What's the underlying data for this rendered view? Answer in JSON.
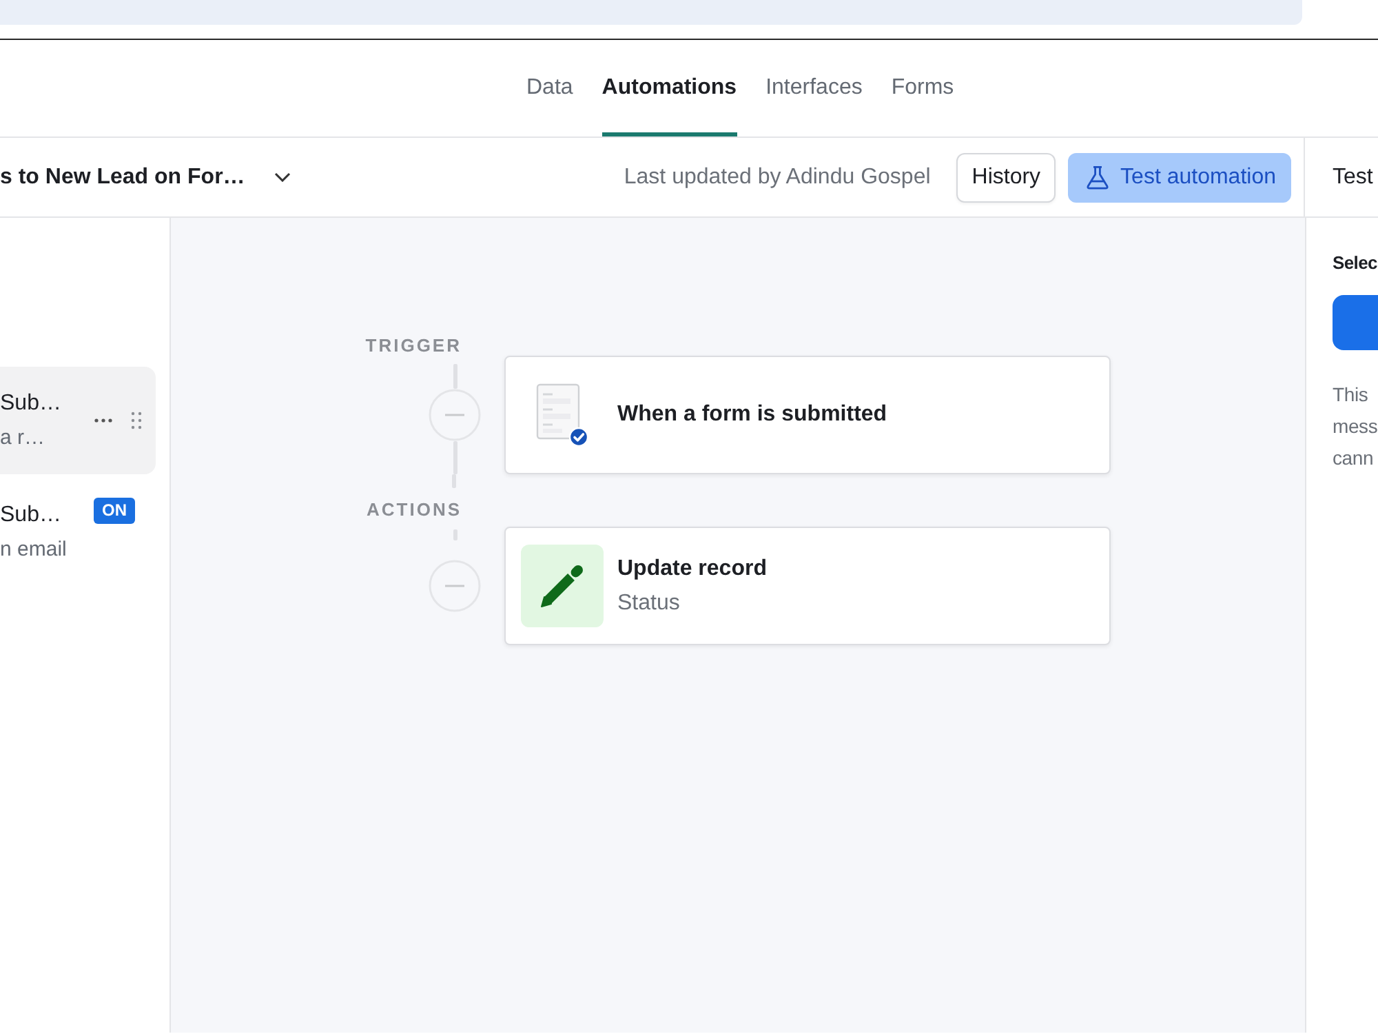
{
  "tabs": [
    {
      "label": "Data",
      "selected": false
    },
    {
      "label": "Automations",
      "selected": true
    },
    {
      "label": "Interfaces",
      "selected": false
    },
    {
      "label": "Forms",
      "selected": false
    }
  ],
  "toolbar": {
    "automation_name": "s to New Lead on For…",
    "last_updated": "Last updated by Adindu Gospel",
    "buttons": [
      {
        "label": "History",
        "kind": "secondary"
      },
      {
        "label": "Test automation",
        "kind": "primary"
      }
    ]
  },
  "sidebar": {
    "items": [
      {
        "title": "Sub…",
        "subtitle": "a r…",
        "selected": true
      },
      {
        "title": "Sub…",
        "subtitle": "n email",
        "selected": false,
        "badge": "ON"
      }
    ]
  },
  "canvas": {
    "sections": [
      {
        "label": "TRIGGER",
        "steps": [
          {
            "kind": "trigger",
            "title": "When a form is submitted"
          }
        ]
      },
      {
        "label": "ACTIONS",
        "steps": [
          {
            "kind": "update",
            "title": "Update record",
            "subtitle": "Status"
          }
        ]
      }
    ]
  },
  "test_panel": {
    "header": "Test",
    "title": "Selec",
    "text": "This mess cann"
  }
}
